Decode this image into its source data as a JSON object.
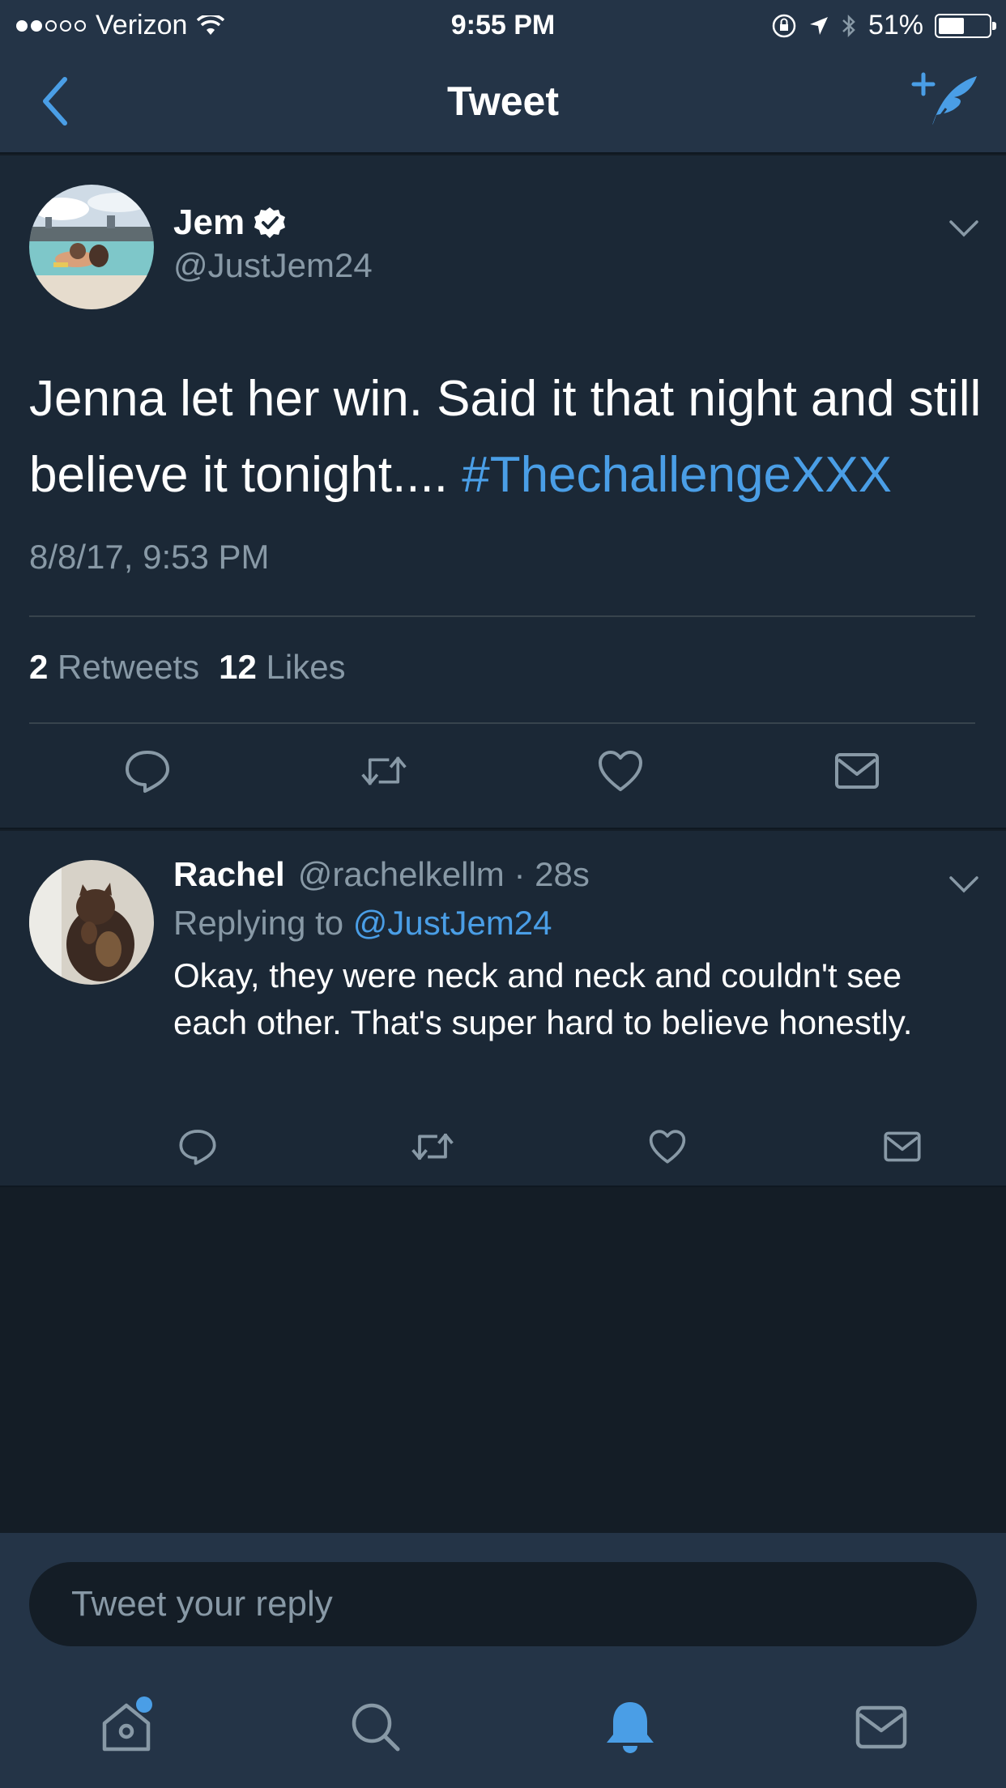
{
  "status_bar": {
    "carrier": "Verizon",
    "time": "9:55 PM",
    "battery": "51%",
    "battery_level": 0.51
  },
  "nav": {
    "title": "Tweet",
    "back_icon": "chevron-left-icon",
    "compose_icon": "compose-tweet-icon"
  },
  "main_tweet": {
    "author_name": "Jem",
    "author_handle": "@JustJem24",
    "text": "Jenna let her win. Said it that night and still believe it tonight.... ",
    "hashtag": "#ThechallengeXXX",
    "timestamp": "8/8/17, 9:53 PM",
    "retweet_count": "2",
    "retweet_label": "Retweets",
    "like_count": "12",
    "like_label": "Likes"
  },
  "reply": {
    "author_name": "Rachel",
    "author_handle": "@rachelkellm",
    "age": "28s",
    "replying_prefix": "Replying to",
    "replying_to": "@JustJem24",
    "text": "Okay, they were neck and neck and couldn't see each other. That's super hard to believe honestly."
  },
  "compose": {
    "placeholder": "Tweet your reply"
  },
  "tabs": [
    "home-icon",
    "search-icon",
    "notifications-icon",
    "messages-icon"
  ],
  "colors": {
    "background": "#141d26",
    "panel": "#1b2836",
    "chrome": "#243447",
    "accent": "#4a9ee6",
    "muted": "#8899a6"
  }
}
